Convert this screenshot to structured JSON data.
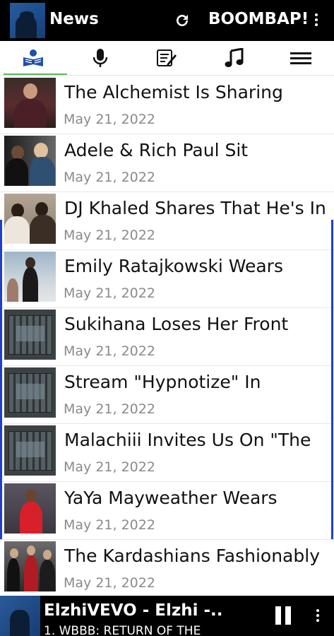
{
  "appbar": {
    "title": "News",
    "brand": "BOOMBAP!",
    "icons": [
      "app-logo",
      "refresh-icon",
      "overflow-menu-icon"
    ]
  },
  "tabs": [
    {
      "icon": "news-reader-icon",
      "selected": true
    },
    {
      "icon": "microphone-icon",
      "selected": false
    },
    {
      "icon": "lyrics-notepad-icon",
      "selected": false
    },
    {
      "icon": "music-note-icon",
      "selected": false
    },
    {
      "icon": "hamburger-menu-icon",
      "selected": false
    }
  ],
  "articles": [
    {
      "title": "The Alchemist Is Sharing",
      "date": "May 21, 2022"
    },
    {
      "title": "Adele & Rich Paul Sit",
      "date": "May 21, 2022"
    },
    {
      "title": "DJ Khaled Shares That He's In",
      "date": "May 21, 2022"
    },
    {
      "title": "Emily Ratajkowski Wears",
      "date": "May 21, 2022"
    },
    {
      "title": "Sukihana Loses Her Front",
      "date": "May 21, 2022"
    },
    {
      "title": "Stream \"Hypnotize\" In",
      "date": "May 21, 2022"
    },
    {
      "title": "Malachiii Invites Us On \"The",
      "date": "May 21, 2022"
    },
    {
      "title": "YaYa Mayweather Wears",
      "date": "May 21, 2022"
    },
    {
      "title": "The Kardashians Fashionably",
      "date": "May 21, 2022"
    }
  ],
  "player": {
    "title": "ElzhiVEVO - Elzhi -..",
    "subtitle": "1. WBBB: RETURN OF THE"
  },
  "colors": {
    "accent_tab": "#5cb85c",
    "scroll_accent": "#1f3fd0",
    "date_text": "#8a8a8a"
  }
}
